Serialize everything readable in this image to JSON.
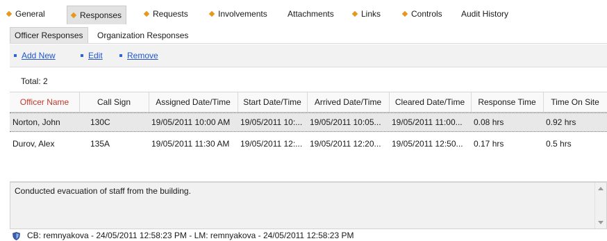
{
  "tabs": [
    {
      "label": "General",
      "icon": "diamond-icon",
      "active": false
    },
    {
      "label": "Responses",
      "icon": "diamond-icon",
      "active": true
    },
    {
      "label": "Requests",
      "icon": "diamond-icon",
      "active": false
    },
    {
      "label": "Involvements",
      "icon": "diamond-icon",
      "active": false
    },
    {
      "label": "Attachments",
      "icon": "",
      "active": false
    },
    {
      "label": "Links",
      "icon": "diamond-icon",
      "active": false
    },
    {
      "label": "Controls",
      "icon": "diamond-icon",
      "active": false
    },
    {
      "label": "Audit History",
      "icon": "",
      "active": false
    }
  ],
  "subtabs": [
    {
      "label": "Officer Responses",
      "active": true
    },
    {
      "label": "Organization Responses",
      "active": false
    }
  ],
  "actions": {
    "add_new": "Add New",
    "edit": "Edit",
    "remove": "Remove"
  },
  "total": "Total: 2",
  "grid": {
    "columns": [
      "Officer Name",
      "Call Sign",
      "Assigned Date/Time",
      "Start Date/Time",
      "Arrived Date/Time",
      "Cleared Date/Time",
      "Response Time",
      "Time On Site"
    ],
    "sorted_column": "Officer Name",
    "rows": [
      {
        "officer": "Norton, John",
        "call_sign": "130C",
        "assigned": "19/05/2011   10:00 AM",
        "start": "19/05/2011   10:...",
        "arrived": "19/05/2011   10:05...",
        "cleared": "19/05/2011   11:00...",
        "response": "0.08 hrs",
        "on_site": "0.92 hrs"
      },
      {
        "officer": "Durov, Alex",
        "call_sign": "135A",
        "assigned": "19/05/2011   11:30 AM",
        "start": "19/05/2011   12:...",
        "arrived": "19/05/2011   12:20...",
        "cleared": "19/05/2011   12:50...",
        "response": "0.17 hrs",
        "on_site": "0.5 hrs"
      }
    ]
  },
  "notes": "Conducted evacuation of staff from the building.",
  "footer": "CB: remnyakova - 24/05/2011 12:58:23 PM - LM: remnyakova - 24/05/2011 12:58:23 PM",
  "colors": {
    "accent_diamond": "#e8961e",
    "link": "#2255cc",
    "sorted_header": "#c0392b"
  }
}
